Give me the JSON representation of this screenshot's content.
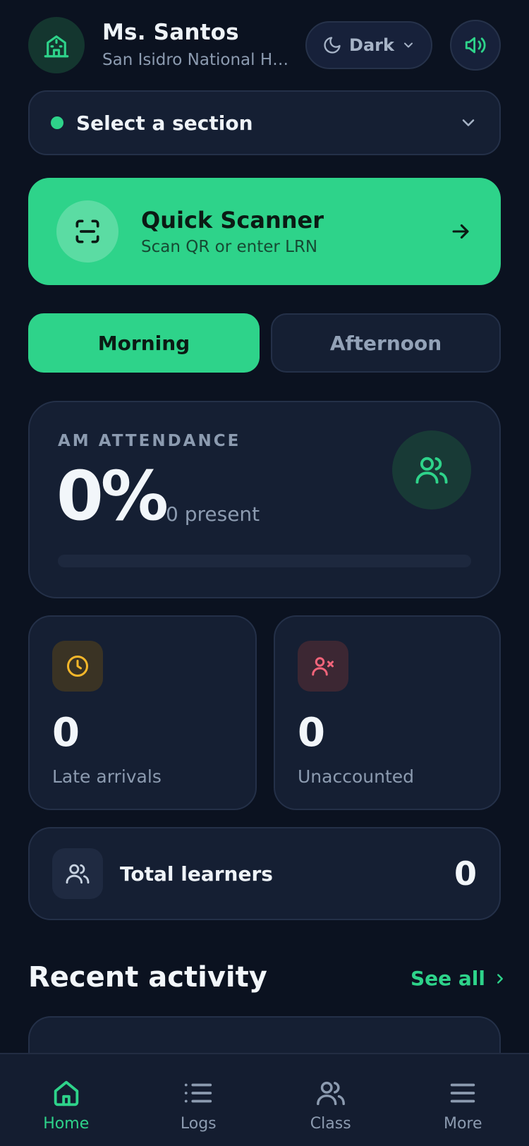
{
  "header": {
    "teacher_name": "Ms. Santos",
    "school_name": "San Isidro National Hi...",
    "theme_label": "Dark"
  },
  "section": {
    "placeholder": "Select a section"
  },
  "scanner": {
    "title": "Quick Scanner",
    "subtitle": "Scan QR or enter LRN"
  },
  "session_tabs": [
    {
      "label": "Morning",
      "active": true
    },
    {
      "label": "Afternoon",
      "active": false
    }
  ],
  "attendance": {
    "label": "AM ATTENDANCE",
    "percent_text": "0%",
    "percent_value": 0,
    "present_text": "0 present"
  },
  "stats": {
    "late": {
      "value": "0",
      "label": "Late arrivals"
    },
    "unaccounted": {
      "value": "0",
      "label": "Unaccounted"
    }
  },
  "total": {
    "label": "Total learners",
    "value": "0"
  },
  "recent": {
    "title": "Recent activity",
    "see_all": "See all"
  },
  "nav": [
    {
      "label": "Home",
      "icon": "home-icon",
      "active": true
    },
    {
      "label": "Logs",
      "icon": "list-icon",
      "active": false
    },
    {
      "label": "Class",
      "icon": "users-icon",
      "active": false
    },
    {
      "label": "More",
      "icon": "menu-icon",
      "active": false
    }
  ],
  "colors": {
    "accent": "#2ed38a",
    "background": "#0b1220",
    "card": "#151f33",
    "late": "#f5b72a",
    "unaccounted": "#f2647a"
  }
}
